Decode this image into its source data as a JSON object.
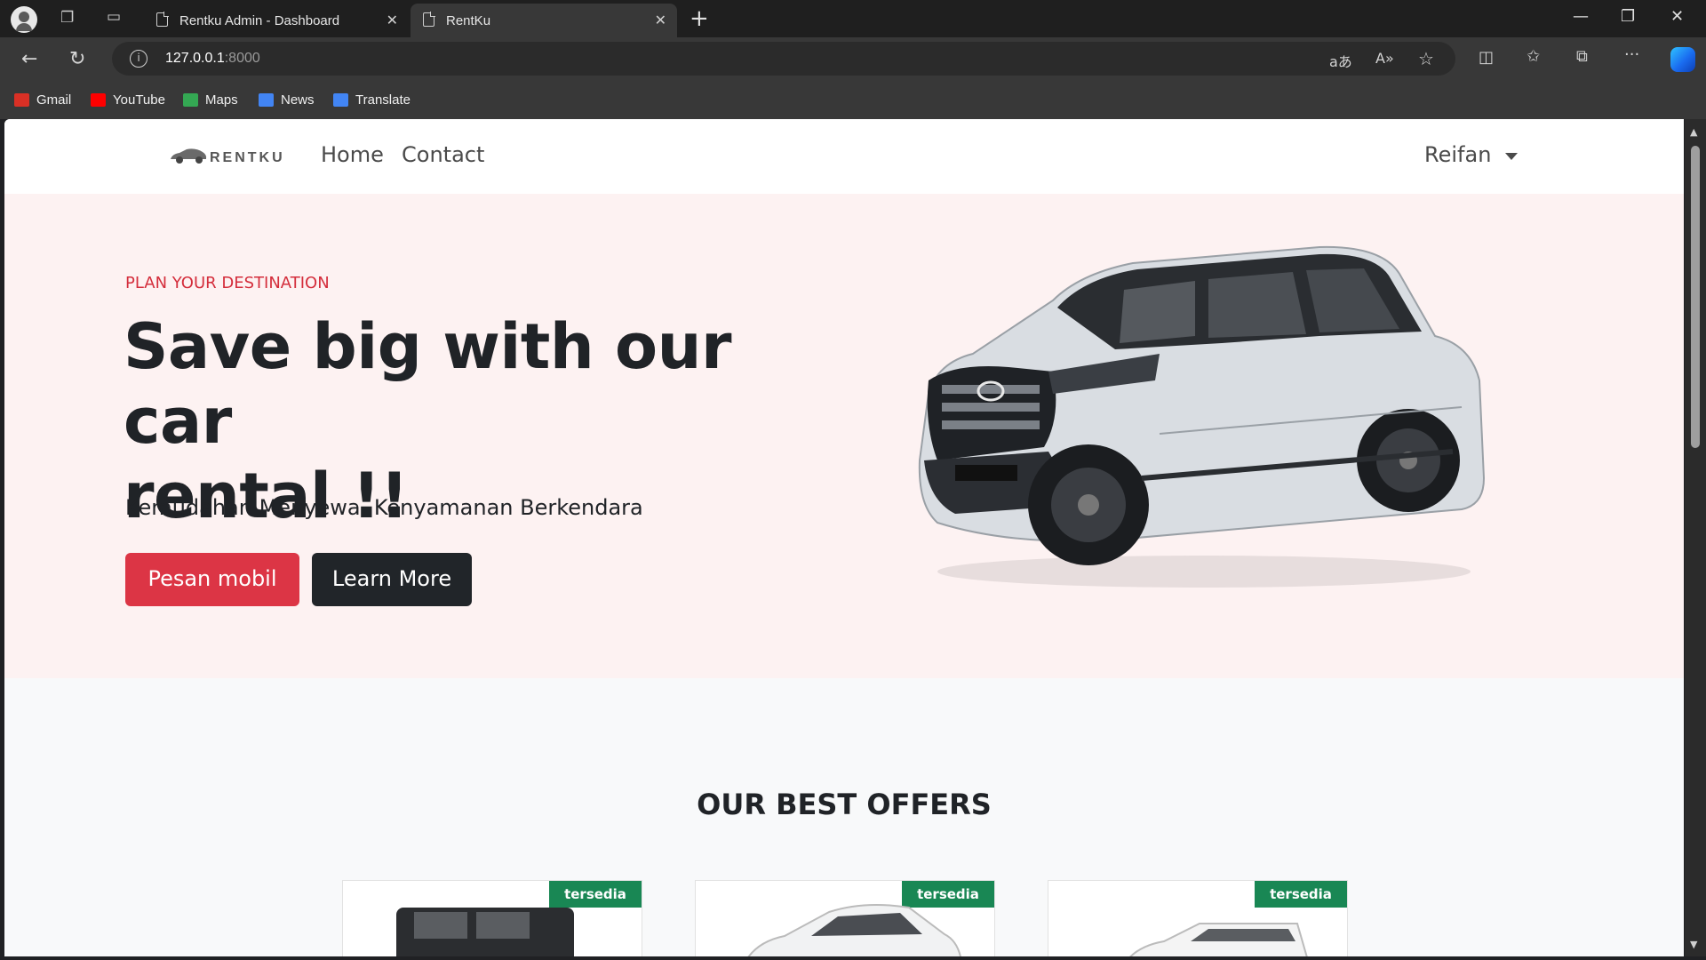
{
  "browser": {
    "tabs": [
      {
        "title": "Rentku Admin - Dashboard"
      },
      {
        "title": "RentKu"
      }
    ],
    "address": {
      "host": "127.0.0.1",
      "port": ":8000"
    },
    "bookmarks": [
      {
        "label": "Gmail",
        "color": "#d93025"
      },
      {
        "label": "YouTube",
        "color": "#ff0000"
      },
      {
        "label": "Maps",
        "color": "#34a853"
      },
      {
        "label": "News",
        "color": "#4285f4"
      },
      {
        "label": "Translate",
        "color": "#4285f4"
      }
    ]
  },
  "site": {
    "brand": "RENTKU",
    "nav": {
      "home": "Home",
      "contact": "Contact"
    },
    "user": "Reifan",
    "hero": {
      "eyebrow": "PLAN YOUR DESTINATION",
      "headline_line1": "Save big with our car",
      "headline_line2": "rental !!",
      "subline": "Kemudahan Menyewa, Kenyamanan Berkendara",
      "primary_button": "Pesan mobil",
      "secondary_button": "Learn More"
    },
    "offers": {
      "title": "OUR BEST OFFERS",
      "cards": [
        {
          "badge": "tersedia"
        },
        {
          "badge": "tersedia"
        },
        {
          "badge": "tersedia"
        }
      ]
    },
    "colors": {
      "accent_red": "#dc3545",
      "dark": "#212529",
      "badge_green": "#198754",
      "hero_bg": "#fdf2f2"
    }
  }
}
